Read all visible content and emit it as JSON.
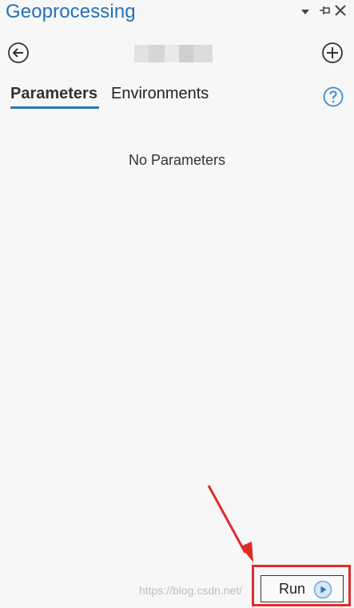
{
  "panel": {
    "title": "Geoprocessing"
  },
  "tabs": [
    {
      "label": "Parameters",
      "active": true
    },
    {
      "label": "Environments",
      "active": false
    }
  ],
  "content": {
    "empty_message": "No Parameters"
  },
  "actions": {
    "run_label": "Run"
  },
  "watermark": {
    "text": "https://blog.csdn.net/"
  },
  "colors": {
    "accent": "#2372b8",
    "annotation": "#e02b2b"
  }
}
